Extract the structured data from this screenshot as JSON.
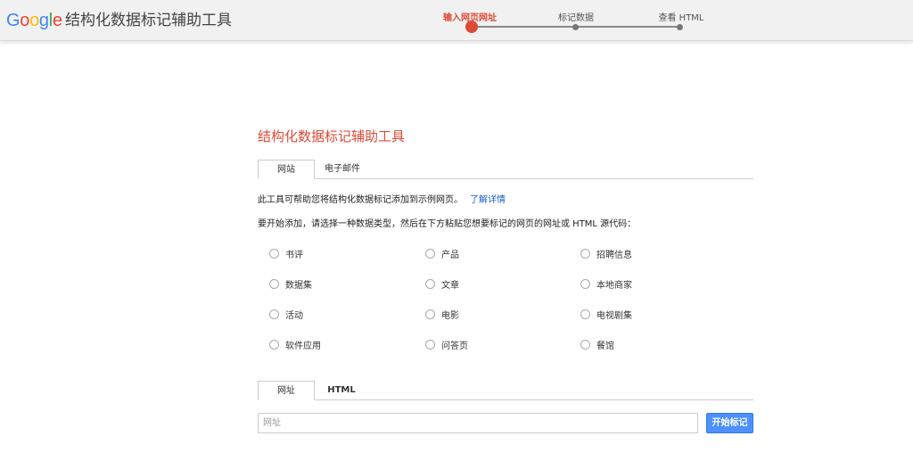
{
  "header": {
    "logo_letters": [
      {
        "char": "G",
        "color": "#4285f4"
      },
      {
        "char": "o",
        "color": "#ea4335"
      },
      {
        "char": "o",
        "color": "#fbbc05"
      },
      {
        "char": "g",
        "color": "#4285f4"
      },
      {
        "char": "l",
        "color": "#34a853"
      },
      {
        "char": "e",
        "color": "#ea4335"
      }
    ],
    "app_title": "结构化数据标记辅助工具",
    "steps": [
      {
        "label": "输入网页网址",
        "active": true
      },
      {
        "label": "标记数据",
        "active": false
      },
      {
        "label": "查看 HTML",
        "active": false
      }
    ]
  },
  "main": {
    "title": "结构化数据标记辅助工具",
    "source_tabs": [
      {
        "label": "网站",
        "active": true
      },
      {
        "label": "电子邮件",
        "active": false
      }
    ],
    "intro_text": "此工具可帮助您将结构化数据标记添加到示例网页。",
    "learn_more_link": "了解详情",
    "instruction_text": "要开始添加，请选择一种数据类型，然后在下方粘贴您想要标记的网页的网址或 HTML 源代码：",
    "data_types": [
      "书评",
      "产品",
      "招聘信息",
      "数据集",
      "文章",
      "本地商家",
      "活动",
      "电影",
      "电视剧集",
      "软件应用",
      "问答页",
      "餐馆"
    ],
    "input_tabs": [
      {
        "label": "网址",
        "active": true
      },
      {
        "label": "HTML",
        "active": false
      }
    ],
    "url_input": {
      "placeholder": "网址",
      "value": ""
    },
    "start_button": "开始标记"
  },
  "colors": {
    "accent_red": "#dd4b39",
    "button_blue": "#4d90fe",
    "link_blue": "#1a5fc2"
  }
}
